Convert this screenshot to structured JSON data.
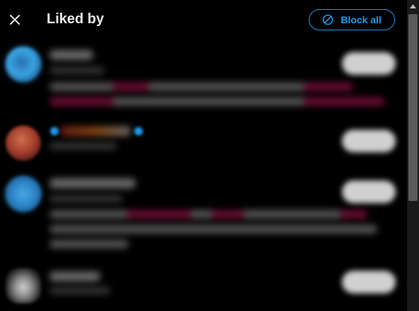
{
  "dialog": {
    "title": "Liked by",
    "close_icon": "close-icon",
    "block_all_label": "Block all",
    "block_all_icon": "block-icon"
  },
  "colors": {
    "background": "#000000",
    "accent": "#1d9bf0",
    "text": "#e7e9ea"
  },
  "users": [
    {
      "avatar": "blue-globe-avatar",
      "has_bio": true,
      "bio_lines": 2
    },
    {
      "avatar": "orange-photo-avatar",
      "verified": true,
      "has_bio": false
    },
    {
      "avatar": "blue-globe-avatar",
      "has_bio": true,
      "bio_lines": 3
    },
    {
      "avatar": "grey-figure-avatar",
      "has_bio": false
    }
  ]
}
